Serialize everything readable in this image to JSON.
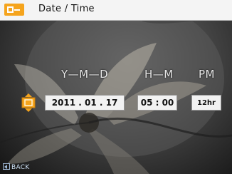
{
  "header": {
    "title": "Date / Time",
    "tab_icon": "settings-tab-icon",
    "accent_color": "#f5a41d"
  },
  "columns": {
    "date": "Y—M—D",
    "time": "H—M",
    "ampm": "PM"
  },
  "fields": {
    "date": "2011 . 01 . 17",
    "time": "05 : 00",
    "format": "12hr"
  },
  "footer": {
    "back_label": "BACK",
    "back_icon": "back-arrow-icon"
  },
  "selector_icon": "up-down-arrow-icon"
}
